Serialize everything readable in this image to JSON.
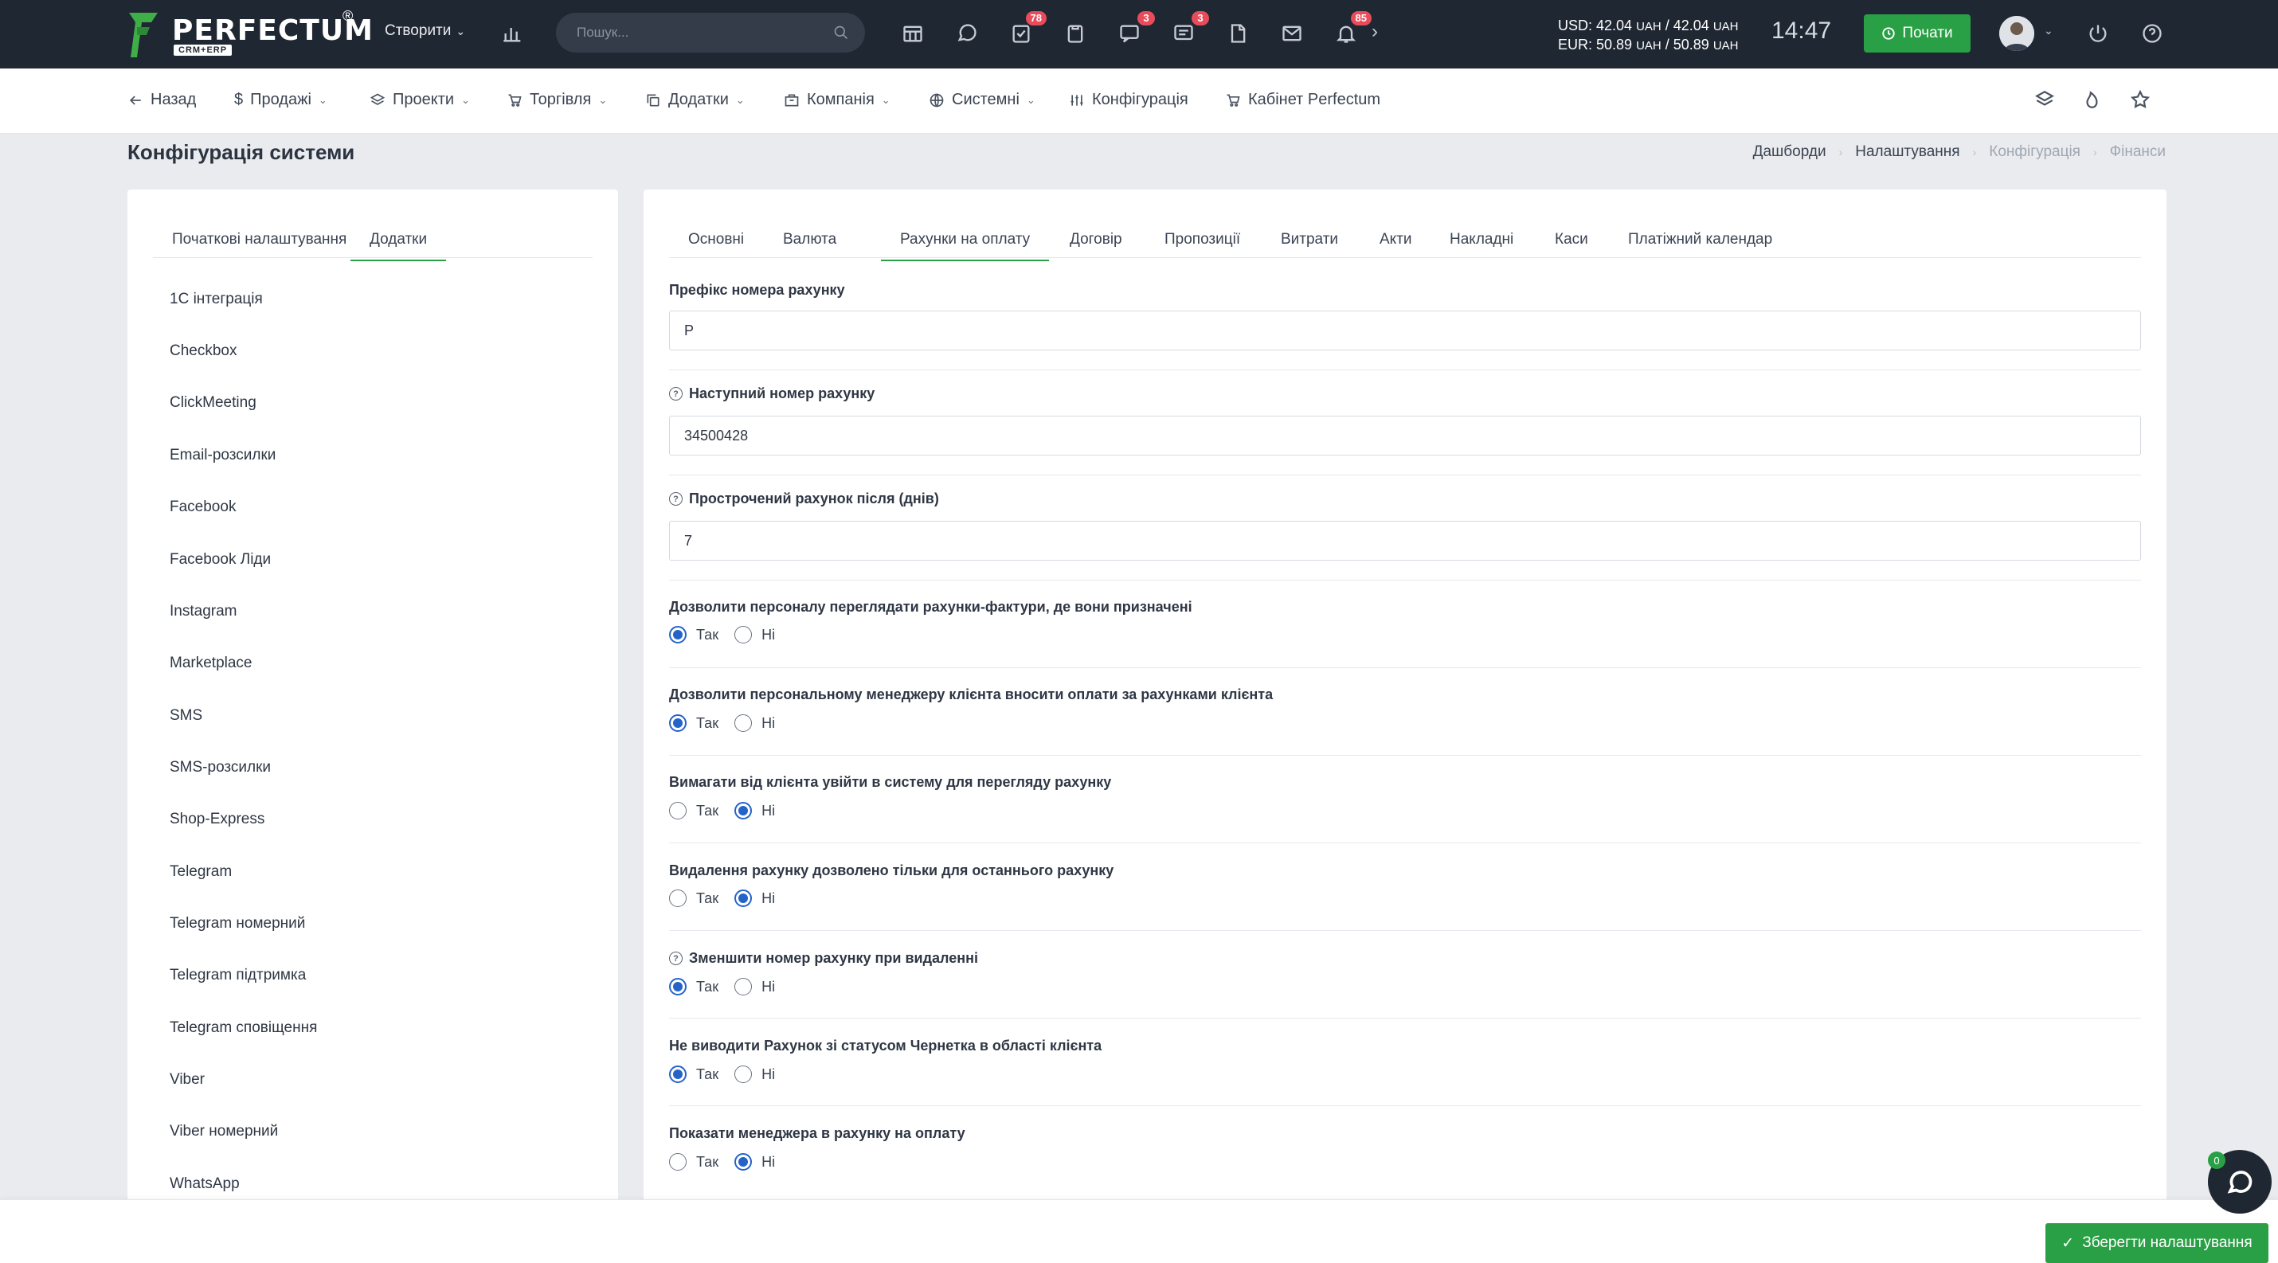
{
  "brand": {
    "name": "PERFECTUM",
    "reg": "®",
    "sub": "CRM+ERP",
    "accent": "#2aa046"
  },
  "topbar": {
    "create_label": "Створити",
    "search_placeholder": "Пошук...",
    "badges": {
      "tasks": "78",
      "chat": "3",
      "messages": "3",
      "notifications": "85"
    },
    "currency_usd": "USD: 42.04",
    "currency_usd_unit1": "UAH",
    "currency_usd_sep": " / 42.04 ",
    "currency_usd_unit2": "UAH",
    "currency_eur": "EUR: 50.89",
    "currency_eur_unit1": "UAH",
    "currency_eur_sep": " / 50.89 ",
    "currency_eur_unit2": "UAH",
    "time": "14:47",
    "start_label": "Почати"
  },
  "nav": {
    "back": "Назад",
    "sales": "Продажі",
    "projects": "Проекти",
    "trade": "Торгівля",
    "addons": "Додатки",
    "company": "Компанія",
    "system": "Системні",
    "config": "Конфігурація",
    "cabinet": "Кабінет Perfectum"
  },
  "page": {
    "title": "Конфігурація системи",
    "breadcrumb": [
      "Дашборди",
      "Налаштування",
      "Конфігурація",
      "Фінанси"
    ]
  },
  "left": {
    "tabs": [
      "Початкові налаштування",
      "Додатки"
    ],
    "items": [
      "1С інтеграція",
      "Checkbox",
      "ClickMeeting",
      "Email-розсилки",
      "Facebook",
      "Facebook Ліди",
      "Instagram",
      "Marketplace",
      "SMS",
      "SMS-розсилки",
      "Shop-Express",
      "Telegram",
      "Telegram номерний",
      "Telegram підтримка",
      "Telegram сповіщення",
      "Viber",
      "Viber номерний",
      "WhatsApp"
    ]
  },
  "right": {
    "tabs": [
      "Основні",
      "Валюта",
      "Рахунки на оплату",
      "Договір",
      "Пропозиції",
      "Витрати",
      "Акти",
      "Накладні",
      "Каси",
      "Платіжний календар"
    ],
    "fields": {
      "prefix_label": "Префікс номера рахунку",
      "prefix_value": "P",
      "next_label": "Наступний номер рахунку",
      "next_value": "34500428",
      "overdue_label": "Прострочений рахунок після (днів)",
      "overdue_value": "7"
    },
    "yes": "Так",
    "no": "Ні",
    "options": [
      {
        "label": "Дозволити персоналу переглядати рахунки-фактури, де вони призначені",
        "value": "yes"
      },
      {
        "label": "Дозволити персональному менеджеру клієнта вносити оплати за рахунками клієнта",
        "value": "yes"
      },
      {
        "label": "Вимагати від клієнта увійти в систему для перегляду рахунку",
        "value": "no"
      },
      {
        "label": "Видалення рахунку дозволено тільки для останнього рахунку",
        "value": "no"
      },
      {
        "label": "Зменшити номер рахунку при видаленні",
        "value": "yes"
      },
      {
        "label": "Не виводити Рахунок зі статусом Чернетка в області клієнта",
        "value": "yes"
      },
      {
        "label": "Показати менеджера в рахунку на оплату",
        "value": "no"
      }
    ]
  },
  "footer": {
    "save_label": "Зберегти налаштування",
    "chat_count": "0"
  }
}
